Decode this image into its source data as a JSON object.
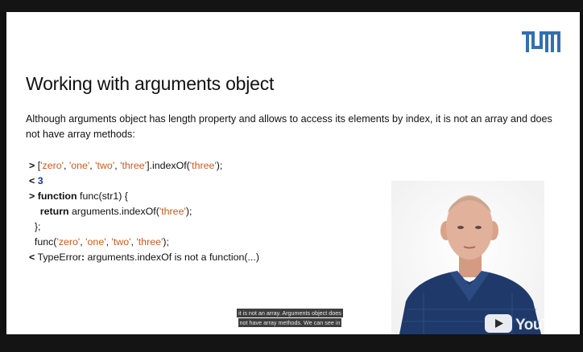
{
  "slide": {
    "title": "Working with arguments object",
    "description": "Although arguments object has length property and allows to access its elements by index, it is not an array and does not have array methods:",
    "code": {
      "l1_prompt": ">",
      "l1_a": " [",
      "l1_s1": "'zero'",
      "l1_c1": ", ",
      "l1_s2": "'one'",
      "l1_c2": ", ",
      "l1_s3": "'two'",
      "l1_c3": ", ",
      "l1_s4": "'three'",
      "l1_b": "].indexOf(",
      "l1_s5": "'three'",
      "l1_end": ");",
      "l2_prompt": "<",
      "l2_value": "3",
      "l3_prompt": ">",
      "l3_kw": "function",
      "l3_rest": " func(str1) {",
      "l4_kw": "return",
      "l4_a": " arguments.indexOf(",
      "l4_s": "'three'",
      "l4_end": ");",
      "l5": "  };",
      "l6_a": "  func(",
      "l6_s1": "'zero'",
      "l6_c1": ", ",
      "l6_s2": "'one'",
      "l6_c2": ", ",
      "l6_s3": "'two'",
      "l6_c3": ", ",
      "l6_s4": "'three'",
      "l6_end": ");",
      "l7_prompt": "<",
      "l7_err": " TypeError",
      "l7_colon": ":",
      "l7_rest": " arguments.indexOf is not a function(...)"
    }
  },
  "caption": {
    "line1": "it is not an array. Arguments object does",
    "line2": "not have array methods. We can see in"
  },
  "colors": {
    "string": "#c85a1e",
    "number": "#1a35a8",
    "tum_blue": "#3070b3"
  },
  "icons": {
    "logo": "tum-logo",
    "watermark": "youtube-logo"
  }
}
